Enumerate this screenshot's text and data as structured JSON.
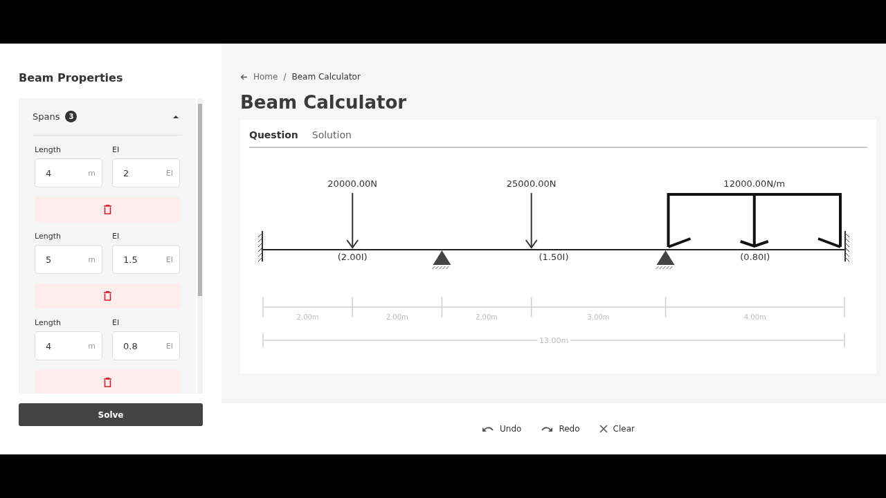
{
  "sidebar": {
    "title": "Beam Properties",
    "spans_panel": {
      "label": "Spans",
      "count": "3",
      "expanded": true,
      "items": [
        {
          "length_label": "Length",
          "length": "4",
          "length_unit": "m",
          "ei_label": "EI",
          "ei": "2",
          "ei_unit": "EI"
        },
        {
          "length_label": "Length",
          "length": "5",
          "length_unit": "m",
          "ei_label": "EI",
          "ei": "1.5",
          "ei_unit": "EI"
        },
        {
          "length_label": "Length",
          "length": "4",
          "length_unit": "m",
          "ei_label": "EI",
          "ei": "0.8",
          "ei_unit": "EI"
        }
      ]
    },
    "solve_button": "Solve"
  },
  "breadcrumb": {
    "items": [
      "Home",
      "Beam Calculator"
    ],
    "separator": "/"
  },
  "page_title": "Beam Calculator",
  "tabs": [
    {
      "label": "Question",
      "selected": true
    },
    {
      "label": "Solution",
      "selected": false
    }
  ],
  "diagram": {
    "start_support": {
      "kind": "fixed"
    },
    "end_support": {
      "kind": "fixed"
    },
    "segments": [
      {
        "label": "2.00m",
        "end": {
          "kind": "point_load",
          "label": "20000.00N"
        }
      },
      {
        "label": "2.00m",
        "end": {
          "kind": "pin"
        }
      },
      {
        "label": "2.00m",
        "end": {
          "kind": "point_load",
          "label": "25000.00N"
        }
      },
      {
        "label": "3.00m",
        "end": {
          "kind": "pin"
        }
      },
      {
        "label": "4.00m",
        "load": {
          "kind": "distributed",
          "label": "12000.00N/m"
        }
      }
    ],
    "span_labels": [
      "(2.00I)",
      "(1.50I)",
      "(0.80I)"
    ],
    "total_length": "13.00m"
  },
  "actions": [
    {
      "kind": "undo",
      "label": "Undo"
    },
    {
      "kind": "redo",
      "label": "Redo"
    },
    {
      "kind": "clear",
      "label": "Clear"
    }
  ]
}
